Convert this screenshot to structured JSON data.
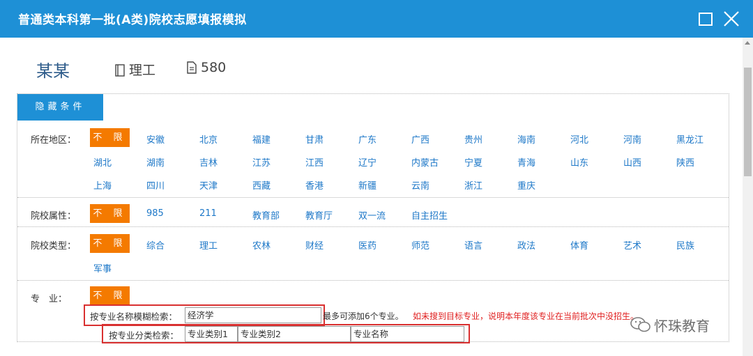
{
  "window": {
    "title": "普通类本科第一批(A类)院校志愿填报模拟"
  },
  "profile": {
    "name": "某某",
    "subject": "理工",
    "score": "580"
  },
  "hide_button": "隐藏条件",
  "no_limit": "不 限",
  "filters": {
    "region": {
      "label": "所在地区：",
      "options": [
        "安徽",
        "北京",
        "福建",
        "甘肃",
        "广东",
        "广西",
        "贵州",
        "海南",
        "河北",
        "河南",
        "黑龙江",
        "湖北",
        "湖南",
        "吉林",
        "江苏",
        "江西",
        "辽宁",
        "内蒙古",
        "宁夏",
        "青海",
        "山东",
        "山西",
        "陕西",
        "上海",
        "四川",
        "天津",
        "西藏",
        "香港",
        "新疆",
        "云南",
        "浙江",
        "重庆"
      ]
    },
    "attribute": {
      "label": "院校属性：",
      "options": [
        "985",
        "211",
        "教育部",
        "教育厅",
        "双一流",
        "自主招生"
      ]
    },
    "type": {
      "label": "院校类型：",
      "options": [
        "综合",
        "理工",
        "农林",
        "财经",
        "医药",
        "师范",
        "语言",
        "政法",
        "体育",
        "艺术",
        "民族",
        "军事"
      ]
    },
    "major": {
      "label": "专　业："
    }
  },
  "fuzzy_search": {
    "label": "按专业名称模糊检索：",
    "value": "经济学"
  },
  "category_search": {
    "label": "按专业分类检索：",
    "field1": "专业类别1",
    "field2": "专业类别2",
    "field3": "专业名称"
  },
  "hints": {
    "max": "最多可添加6个专业。",
    "warning": "如未搜到目标专业，说明本年度该专业在当前批次中没招生。"
  },
  "watermark": "怀珠教育"
}
